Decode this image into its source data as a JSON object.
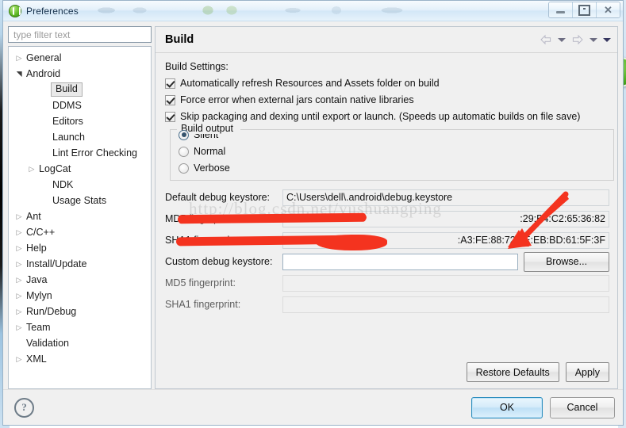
{
  "window": {
    "title": "Preferences",
    "icon": "eclipse-preferences-icon",
    "controls": {
      "minimize": "Minimize",
      "restore": "Restore",
      "close": "Close"
    }
  },
  "filter": {
    "placeholder": "type filter text",
    "value": ""
  },
  "tree": {
    "items": [
      {
        "label": "General",
        "indent": 1,
        "arrow": "collapsed",
        "selected": false
      },
      {
        "label": "Android",
        "indent": 1,
        "arrow": "expanded",
        "selected": false
      },
      {
        "label": "Build",
        "indent": 3,
        "arrow": "none",
        "selected": true
      },
      {
        "label": "DDMS",
        "indent": 3,
        "arrow": "none",
        "selected": false
      },
      {
        "label": "Editors",
        "indent": 3,
        "arrow": "none",
        "selected": false
      },
      {
        "label": "Launch",
        "indent": 3,
        "arrow": "none",
        "selected": false
      },
      {
        "label": "Lint Error Checking",
        "indent": 3,
        "arrow": "none",
        "selected": false
      },
      {
        "label": "LogCat",
        "indent": 2,
        "arrow": "collapsed",
        "selected": false
      },
      {
        "label": "NDK",
        "indent": 3,
        "arrow": "none",
        "selected": false
      },
      {
        "label": "Usage Stats",
        "indent": 3,
        "arrow": "none",
        "selected": false
      },
      {
        "label": "Ant",
        "indent": 1,
        "arrow": "collapsed",
        "selected": false
      },
      {
        "label": "C/C++",
        "indent": 1,
        "arrow": "collapsed",
        "selected": false
      },
      {
        "label": "Help",
        "indent": 1,
        "arrow": "collapsed",
        "selected": false
      },
      {
        "label": "Install/Update",
        "indent": 1,
        "arrow": "collapsed",
        "selected": false
      },
      {
        "label": "Java",
        "indent": 1,
        "arrow": "collapsed",
        "selected": false
      },
      {
        "label": "Mylyn",
        "indent": 1,
        "arrow": "collapsed",
        "selected": false
      },
      {
        "label": "Run/Debug",
        "indent": 1,
        "arrow": "collapsed",
        "selected": false
      },
      {
        "label": "Team",
        "indent": 1,
        "arrow": "collapsed",
        "selected": false
      },
      {
        "label": "Validation",
        "indent": 1,
        "arrow": "none",
        "selected": false
      },
      {
        "label": "XML",
        "indent": 1,
        "arrow": "collapsed",
        "selected": false
      }
    ]
  },
  "page": {
    "title": "Build",
    "nav": {
      "back_icon": "back-arrow-icon",
      "back_menu_icon": "chevron-down-icon",
      "forward_icon": "forward-arrow-icon",
      "forward_menu_icon": "chevron-down-icon",
      "view_menu_icon": "chevron-down-icon"
    },
    "settings_label": "Build Settings:",
    "checkboxes": [
      {
        "label": "Automatically refresh Resources and Assets folder on build",
        "checked": true
      },
      {
        "label": "Force error when external jars contain native libraries",
        "checked": true
      },
      {
        "label": "Skip packaging and dexing until export or launch. (Speeds up automatic builds on file save)",
        "checked": true
      }
    ],
    "build_output": {
      "legend": "Build output",
      "options": [
        {
          "label": "Silent",
          "selected": true
        },
        {
          "label": "Normal",
          "selected": false
        },
        {
          "label": "Verbose",
          "selected": false
        }
      ]
    },
    "fields": [
      {
        "label": "Default debug keystore:",
        "value": "C:\\Users\\dell\\.android\\debug.keystore",
        "state": "readonly",
        "dim": false
      },
      {
        "label": "MD5 fingerprint:",
        "value": ":29:B4:C2:65:36:82",
        "state": "readonly",
        "dim": false
      },
      {
        "label": "SHA1 fingerprint:",
        "value": ":A3:FE:88:72:3E:EB:BD:61:5F:3F",
        "state": "readonly",
        "dim": false
      },
      {
        "label": "Custom debug keystore:",
        "value": "",
        "state": "editable",
        "dim": false
      },
      {
        "label": "MD5 fingerprint:",
        "value": "",
        "state": "disabled",
        "dim": true
      },
      {
        "label": "SHA1 fingerprint:",
        "value": "",
        "state": "disabled",
        "dim": true
      }
    ],
    "browse_label": "Browse...",
    "restore_defaults_label": "Restore Defaults",
    "apply_label": "Apply"
  },
  "footer": {
    "help_icon": "help-question-icon",
    "ok_label": "OK",
    "cancel_label": "Cancel"
  },
  "annotations": {
    "watermark": "http://blog.csdn.net/yushuangping",
    "arrow_color": "#f4331f",
    "redaction_color": "#f4331f"
  },
  "colors": {
    "dialog_bg": "#f0f0f0",
    "titlebar": "#dfeefa",
    "accent_ok": "#2c8dbe",
    "tree_bg": "#ffffff"
  }
}
